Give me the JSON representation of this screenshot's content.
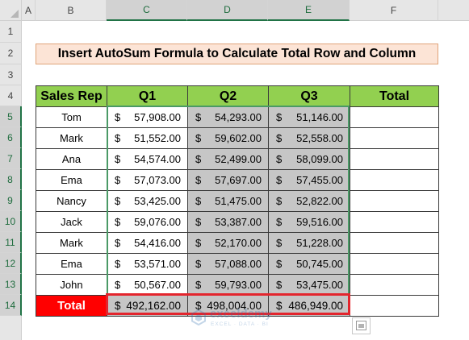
{
  "column_headers": [
    "A",
    "B",
    "C",
    "D",
    "E",
    "F"
  ],
  "row_headers": [
    "1",
    "2",
    "3",
    "4",
    "5",
    "6",
    "7",
    "8",
    "9",
    "10",
    "11",
    "12",
    "13",
    "14"
  ],
  "title": "Insert AutoSum Formula to Calculate Total Row and Column",
  "table": {
    "headers": [
      "Sales Rep",
      "Q1",
      "Q2",
      "Q3",
      "Total"
    ],
    "currency_symbol": "$",
    "rows": [
      {
        "name": "Tom",
        "q1": "57,908.00",
        "q2": "54,293.00",
        "q3": "51,146.00"
      },
      {
        "name": "Mark",
        "q1": "51,552.00",
        "q2": "59,602.00",
        "q3": "52,558.00"
      },
      {
        "name": "Ana",
        "q1": "54,574.00",
        "q2": "52,499.00",
        "q3": "58,099.00"
      },
      {
        "name": "Ema",
        "q1": "57,073.00",
        "q2": "57,697.00",
        "q3": "57,455.00"
      },
      {
        "name": "Nancy",
        "q1": "53,425.00",
        "q2": "51,475.00",
        "q3": "52,822.00"
      },
      {
        "name": "Jack",
        "q1": "59,076.00",
        "q2": "53,387.00",
        "q3": "59,516.00"
      },
      {
        "name": "Mark",
        "q1": "54,416.00",
        "q2": "52,170.00",
        "q3": "51,228.00"
      },
      {
        "name": "Ema",
        "q1": "53,571.00",
        "q2": "57,088.00",
        "q3": "50,745.00"
      },
      {
        "name": "John",
        "q1": "50,567.00",
        "q2": "59,793.00",
        "q3": "53,475.00"
      }
    ],
    "total_row": {
      "label": "Total",
      "q1": "492,162.00",
      "q2": "498,004.00",
      "q3": "486,949.00"
    }
  },
  "watermark": {
    "brand": "exceldemy",
    "tagline": "EXCEL · DATA · BI"
  },
  "colors": {
    "header_green": "#92d050",
    "title_fill": "#fce4d6",
    "total_red": "#ff0000",
    "selection_fill": "#c6c6c6",
    "selection_border": "#217346"
  },
  "icons": {
    "quick_analysis": "quick-analysis-icon",
    "select_all": "select-all-triangle-icon"
  }
}
